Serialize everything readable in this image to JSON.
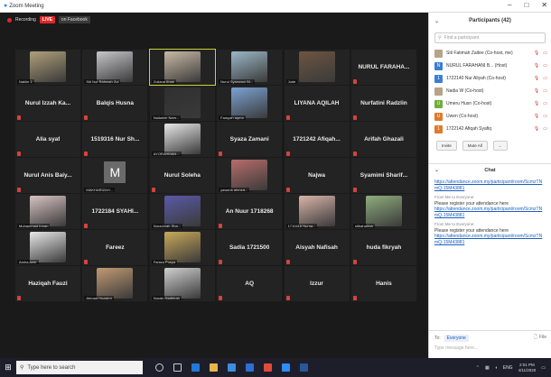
{
  "window": {
    "title": "Zoom Meeting",
    "min": "–",
    "max": "□",
    "close": "✕"
  },
  "recording": {
    "label": "Recording",
    "live": "LIVE",
    "platform": "on Facebook"
  },
  "tiles": [
    {
      "kind": "video",
      "caption": "Nabile 1",
      "color": "#b0a07a"
    },
    {
      "kind": "video",
      "caption": "Siti Nor Rahmah Zul",
      "color": "#c7c7cc"
    },
    {
      "kind": "video",
      "caption": "Zuliana Ahak",
      "color": "#c9b9a5",
      "active": true
    },
    {
      "kind": "video",
      "caption": "Nurul Syazwani Bt...",
      "color": "#9bb8c7"
    },
    {
      "kind": "video",
      "caption": "Jude",
      "color": "#6d5540"
    },
    {
      "kind": "name",
      "name": "NURUL FARAHA..."
    },
    {
      "kind": "name",
      "name": "Nurul Izzah Ka..."
    },
    {
      "kind": "name",
      "name": "Balqis Husna"
    },
    {
      "kind": "video",
      "caption": "Nailahim Nam...",
      "color": "#2f2f2f"
    },
    {
      "kind": "video",
      "caption": "Farsyah aqma",
      "color": "#7ba3d4"
    },
    {
      "kind": "name",
      "name": "LIYANA AQILAH"
    },
    {
      "kind": "name",
      "name": "Nurfatini Radzlin"
    },
    {
      "kind": "name",
      "name": "Alia syaf"
    },
    {
      "kind": "name",
      "name": "1519316 Nur Sh..."
    },
    {
      "kind": "video",
      "caption": "AYORAHMAN...",
      "color": "#e8e8e8"
    },
    {
      "kind": "name",
      "name": "Syaza Zamani"
    },
    {
      "kind": "name",
      "name": "1721242 Afiqah..."
    },
    {
      "kind": "name",
      "name": "Arifah Ghazali"
    },
    {
      "kind": "name",
      "name": "Nurul Anis Baiy..."
    },
    {
      "kind": "letter",
      "letter": "M",
      "caption": "MAKHARIZAH..."
    },
    {
      "kind": "name",
      "name": "Nurul Soleha"
    },
    {
      "kind": "video",
      "caption": "yawaris ahmed...",
      "color": "#b86d6a"
    },
    {
      "kind": "name",
      "name": "Najwa"
    },
    {
      "kind": "name",
      "name": "Syamimi Sharif..."
    },
    {
      "kind": "video",
      "caption": "Muhammad Imran",
      "color": "#d8c2c2"
    },
    {
      "kind": "name",
      "name": "1722184 SYAHI..."
    },
    {
      "kind": "video",
      "caption": "Nurzuhrah Sha...",
      "color": "#5a5aa8"
    },
    {
      "kind": "name",
      "name": "An Nuur 1718268"
    },
    {
      "kind": "video",
      "caption": "1710416 Nurna...",
      "color": "#d9b4a8"
    },
    {
      "kind": "video",
      "caption": "sithahalimh",
      "color": "#8fae7e"
    },
    {
      "kind": "video",
      "caption": "Amira Amir",
      "color": "#e8e8e8"
    },
    {
      "kind": "name",
      "name": "Fareez"
    },
    {
      "kind": "video",
      "caption": "Faniza Puspa",
      "color": "#c9a85a"
    },
    {
      "kind": "name",
      "name": "Sadia 1721500"
    },
    {
      "kind": "name",
      "name": "Aisyah Nafisah"
    },
    {
      "kind": "name",
      "name": "huda fikryah"
    },
    {
      "kind": "name",
      "name": "Haziqah Fauzi"
    },
    {
      "kind": "video",
      "caption": "Ahmad Huzaimi",
      "color": "#c29a72"
    },
    {
      "kind": "video",
      "caption": "Nurain Nadhirah",
      "color": "#d0d0d0"
    },
    {
      "kind": "name",
      "name": "AQ"
    },
    {
      "kind": "name",
      "name": "Izzur"
    },
    {
      "kind": "name",
      "name": "Hanis"
    }
  ],
  "participants": {
    "title": "Participants (42)",
    "search_placeholder": "Find a participant",
    "items": [
      {
        "name": "Siti Fatimah Zaitee (Co-host, me)",
        "initial": "",
        "color": "#b8a28a"
      },
      {
        "name": "NURUL FARAHANI B... (Host)",
        "initial": "N",
        "color": "#3b7fd4"
      },
      {
        "name": "1722140 Nur Aliyah (Co-host)",
        "initial": "1",
        "color": "#3b7fd4"
      },
      {
        "name": "Nadia W (Co-host)",
        "initial": "",
        "color": "#b8a28a"
      },
      {
        "name": "Umeru Husn (Co-host)",
        "initial": "U",
        "color": "#6fae3b"
      },
      {
        "name": "Uwen (Co-host)",
        "initial": "U",
        "color": "#e07a2a"
      },
      {
        "name": "1722142 Afiqah Syafiq",
        "initial": "1",
        "color": "#e07a2a"
      }
    ],
    "invite_label": "Invite",
    "mute_all_label": "Mute All",
    "more_label": "..."
  },
  "chat": {
    "title": "Chat",
    "messages": [
      {
        "from": "",
        "text": "",
        "link": "https://attendance.zoom.my/participant/room/ScmzTNmQ-15M43881"
      },
      {
        "from": "From Me to Everyone:",
        "text": "Please register your attendance here",
        "link": "https://attendance.zoom.my/participant/room/ScmzTNmQ-15M43881"
      },
      {
        "from": "From Me to Everyone:",
        "text": "Please register your attendance here",
        "link": "https://attendance.zoom.my/participant/room/ScmzTNmQ-15M43881"
      }
    ],
    "to_label": "To:",
    "to_value": "Everyone",
    "file_label": "File",
    "input_placeholder": "Type message here..."
  },
  "taskbar": {
    "search_placeholder": "Type here to search",
    "time": "2:01 PM",
    "date": "4/11/2020",
    "lang": "ENG"
  }
}
